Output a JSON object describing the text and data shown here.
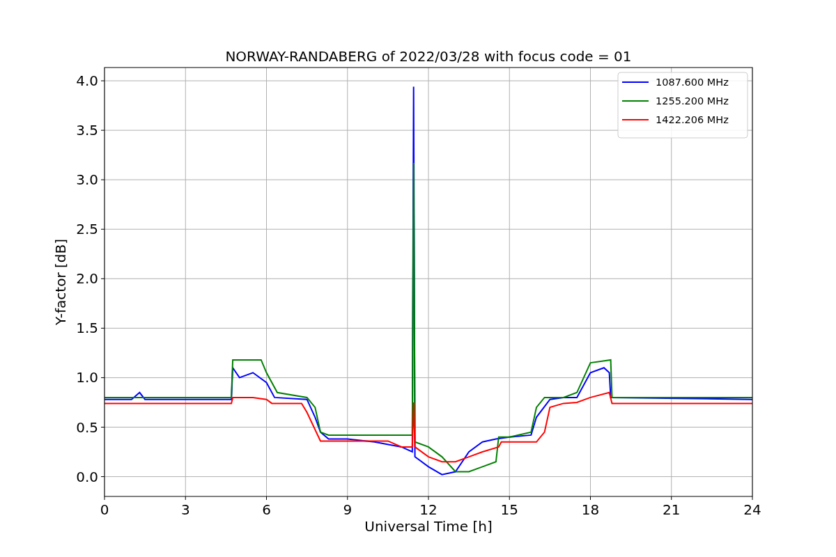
{
  "figure": {
    "chart_data": {
      "type": "line",
      "title": "NORWAY-RANDABERG of 2022/03/28 with focus code = 01",
      "xlabel": "Universal Time [h]",
      "ylabel": "Y-factor [dB]",
      "xlim": [
        0,
        24
      ],
      "ylim": [
        -0.2,
        4.134
      ],
      "grid": true,
      "legend": true,
      "xticks": [
        0,
        3,
        6,
        9,
        12,
        15,
        18,
        21,
        24
      ],
      "yticks": [
        {
          "value": 0,
          "label": "0.0"
        },
        {
          "value": 0.5,
          "label": "0.5"
        },
        {
          "value": 1,
          "label": "1.0"
        },
        {
          "value": 1.5,
          "label": "1.5"
        },
        {
          "value": 2,
          "label": "2.0"
        },
        {
          "value": 2.5,
          "label": "2.5"
        },
        {
          "value": 3,
          "label": "3.0"
        },
        {
          "value": 3.5,
          "label": "3.5"
        },
        {
          "value": 4,
          "label": "4.0"
        }
      ],
      "series": [
        {
          "name": "1087.600 MHz",
          "color": "#0000ff",
          "x": [
            0,
            1,
            1.3,
            1.5,
            4.7,
            4.75,
            5,
            5.5,
            6,
            6.3,
            7.5,
            7.8,
            8,
            8.3,
            9,
            10,
            11,
            11.4,
            11.45,
            11.5,
            12,
            12.5,
            13,
            13.5,
            14,
            14.5,
            15,
            15.8,
            16,
            16.5,
            17,
            17.5,
            18,
            18.5,
            18.7,
            18.75,
            24
          ],
          "values": [
            0.78,
            0.78,
            0.85,
            0.78,
            0.78,
            1.1,
            1.0,
            1.05,
            0.95,
            0.8,
            0.78,
            0.6,
            0.45,
            0.38,
            0.38,
            0.35,
            0.3,
            0.25,
            3.94,
            0.2,
            0.1,
            0.02,
            0.05,
            0.25,
            0.35,
            0.38,
            0.4,
            0.42,
            0.6,
            0.78,
            0.8,
            0.8,
            1.05,
            1.1,
            1.05,
            0.8,
            0.78
          ]
        },
        {
          "name": "1255.200 MHz",
          "color": "#008000",
          "x": [
            0,
            4.7,
            4.75,
            5.8,
            6,
            6.4,
            7.5,
            7.8,
            8,
            8.3,
            9,
            11.4,
            11.45,
            11.5,
            12,
            12.5,
            13,
            13.5,
            14,
            14.5,
            14.6,
            15,
            15.8,
            16,
            16.3,
            17,
            17.5,
            18,
            18.75,
            18.8,
            24
          ],
          "values": [
            0.8,
            0.8,
            1.18,
            1.18,
            1.05,
            0.85,
            0.8,
            0.7,
            0.45,
            0.42,
            0.42,
            0.42,
            3.17,
            0.35,
            0.3,
            0.2,
            0.05,
            0.05,
            0.1,
            0.15,
            0.4,
            0.4,
            0.45,
            0.7,
            0.8,
            0.8,
            0.85,
            1.15,
            1.18,
            0.8,
            0.8
          ]
        },
        {
          "name": "1422.206 MHz",
          "color": "#ff0000",
          "x": [
            0,
            4.7,
            4.75,
            5.5,
            6,
            6.2,
            7.3,
            7.5,
            8,
            10.5,
            11,
            11.4,
            11.45,
            11.5,
            12,
            12.5,
            13,
            13.5,
            14,
            14.6,
            14.7,
            16,
            16.3,
            16.5,
            17,
            17.5,
            18,
            18.7,
            18.8,
            24
          ],
          "values": [
            0.74,
            0.74,
            0.8,
            0.8,
            0.78,
            0.74,
            0.74,
            0.65,
            0.36,
            0.36,
            0.3,
            0.3,
            0.75,
            0.3,
            0.2,
            0.15,
            0.15,
            0.2,
            0.25,
            0.3,
            0.35,
            0.35,
            0.45,
            0.7,
            0.74,
            0.75,
            0.8,
            0.85,
            0.74,
            0.74
          ]
        }
      ]
    }
  }
}
